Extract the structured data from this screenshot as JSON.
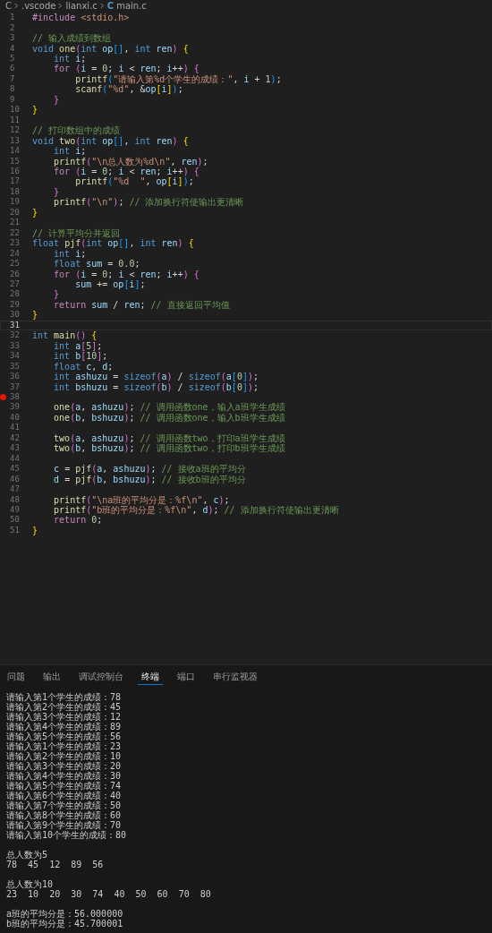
{
  "breadcrumb": [
    {
      "text": "C"
    },
    {
      "text": ".vscode"
    },
    {
      "text": "lianxi.c"
    },
    {
      "text": "main.c",
      "icon_label": "C"
    }
  ],
  "code_lines": [
    {
      "n": "1",
      "current": false,
      "breakpoint": false,
      "tokens": [
        {
          "kind": "ctl",
          "text": "#include "
        },
        {
          "kind": "str",
          "text": "<stdio.h>"
        }
      ]
    },
    {
      "n": "2",
      "current": false,
      "breakpoint": false
    },
    {
      "n": "3",
      "current": false,
      "breakpoint": false,
      "tokens": [
        {
          "kind": "cmt",
          "text": "// 输入成绩到数组"
        }
      ]
    },
    {
      "n": "4",
      "current": false,
      "breakpoint": false,
      "tokens": [
        {
          "kind": "kw",
          "text": "void "
        },
        {
          "kind": "fn",
          "text": "one"
        },
        {
          "kind": "br2",
          "text": "("
        },
        {
          "kind": "kw",
          "text": "int"
        },
        {
          "kind": "var",
          "text": " op"
        },
        {
          "kind": "br3",
          "text": "[]"
        },
        {
          "kind": "pun",
          "text": ", "
        },
        {
          "kind": "kw",
          "text": "int"
        },
        {
          "kind": "var",
          "text": " ren"
        },
        {
          "kind": "br2",
          "text": ") "
        },
        {
          "kind": "br1",
          "text": "{"
        }
      ]
    },
    {
      "n": "5",
      "current": false,
      "breakpoint": false,
      "tokens": [
        {
          "kind": "kw",
          "text": "    int"
        },
        {
          "kind": "var",
          "text": " i"
        },
        {
          "kind": "pun",
          "text": ";"
        }
      ]
    },
    {
      "n": "6",
      "current": false,
      "breakpoint": false,
      "tokens": [
        {
          "kind": "ctl",
          "text": "    for "
        },
        {
          "kind": "br2",
          "text": "("
        },
        {
          "kind": "var",
          "text": "i"
        },
        {
          "kind": "pun",
          "text": " = "
        },
        {
          "kind": "num",
          "text": "0"
        },
        {
          "kind": "pun",
          "text": "; "
        },
        {
          "kind": "var",
          "text": "i"
        },
        {
          "kind": "pun",
          "text": " < "
        },
        {
          "kind": "var",
          "text": "ren"
        },
        {
          "kind": "pun",
          "text": "; "
        },
        {
          "kind": "var",
          "text": "i"
        },
        {
          "kind": "pun",
          "text": "++"
        },
        {
          "kind": "br2",
          "text": ") {"
        }
      ]
    },
    {
      "n": "7",
      "current": false,
      "breakpoint": false,
      "tokens": [
        {
          "kind": "fn",
          "text": "        printf"
        },
        {
          "kind": "br3",
          "text": "("
        },
        {
          "kind": "str",
          "text": "\"请输入第%d个学生的成绩：\""
        },
        {
          "kind": "pun",
          "text": ", "
        },
        {
          "kind": "var",
          "text": "i"
        },
        {
          "kind": "pun",
          "text": " + "
        },
        {
          "kind": "num",
          "text": "1"
        },
        {
          "kind": "br3",
          "text": ")"
        },
        {
          "kind": "pun",
          "text": ";"
        }
      ]
    },
    {
      "n": "8",
      "current": false,
      "breakpoint": false,
      "tokens": [
        {
          "kind": "fn",
          "text": "        scanf"
        },
        {
          "kind": "br3",
          "text": "("
        },
        {
          "kind": "str",
          "text": "\"%d\""
        },
        {
          "kind": "pun",
          "text": ", &"
        },
        {
          "kind": "var",
          "text": "op"
        },
        {
          "kind": "br1",
          "text": "["
        },
        {
          "kind": "var",
          "text": "i"
        },
        {
          "kind": "br1",
          "text": "]"
        },
        {
          "kind": "br3",
          "text": ")"
        },
        {
          "kind": "pun",
          "text": ";"
        }
      ]
    },
    {
      "n": "9",
      "current": false,
      "breakpoint": false,
      "tokens": [
        {
          "kind": "br2",
          "text": "    }"
        }
      ]
    },
    {
      "n": "10",
      "current": false,
      "breakpoint": false,
      "tokens": [
        {
          "kind": "br1",
          "text": "}"
        }
      ]
    },
    {
      "n": "11",
      "current": false,
      "breakpoint": false
    },
    {
      "n": "12",
      "current": false,
      "breakpoint": false,
      "tokens": [
        {
          "kind": "cmt",
          "text": "// 打印数组中的成绩"
        }
      ]
    },
    {
      "n": "13",
      "current": false,
      "breakpoint": false,
      "tokens": [
        {
          "kind": "kw",
          "text": "void "
        },
        {
          "kind": "fn",
          "text": "two"
        },
        {
          "kind": "br2",
          "text": "("
        },
        {
          "kind": "kw",
          "text": "int"
        },
        {
          "kind": "var",
          "text": " op"
        },
        {
          "kind": "br3",
          "text": "[]"
        },
        {
          "kind": "pun",
          "text": ", "
        },
        {
          "kind": "kw",
          "text": "int"
        },
        {
          "kind": "var",
          "text": " ren"
        },
        {
          "kind": "br2",
          "text": ") "
        },
        {
          "kind": "br1",
          "text": "{"
        }
      ]
    },
    {
      "n": "14",
      "current": false,
      "breakpoint": false,
      "tokens": [
        {
          "kind": "kw",
          "text": "    int"
        },
        {
          "kind": "var",
          "text": " i"
        },
        {
          "kind": "pun",
          "text": ";"
        }
      ]
    },
    {
      "n": "15",
      "current": false,
      "breakpoint": false,
      "tokens": [
        {
          "kind": "fn",
          "text": "    printf"
        },
        {
          "kind": "br2",
          "text": "("
        },
        {
          "kind": "str",
          "text": "\"\\n总人数为%d\\n\""
        },
        {
          "kind": "pun",
          "text": ", "
        },
        {
          "kind": "var",
          "text": "ren"
        },
        {
          "kind": "br2",
          "text": ")"
        },
        {
          "kind": "pun",
          "text": ";"
        }
      ]
    },
    {
      "n": "16",
      "current": false,
      "breakpoint": false,
      "tokens": [
        {
          "kind": "ctl",
          "text": "    for "
        },
        {
          "kind": "br2",
          "text": "("
        },
        {
          "kind": "var",
          "text": "i"
        },
        {
          "kind": "pun",
          "text": " = "
        },
        {
          "kind": "num",
          "text": "0"
        },
        {
          "kind": "pun",
          "text": "; "
        },
        {
          "kind": "var",
          "text": "i"
        },
        {
          "kind": "pun",
          "text": " < "
        },
        {
          "kind": "var",
          "text": "ren"
        },
        {
          "kind": "pun",
          "text": "; "
        },
        {
          "kind": "var",
          "text": "i"
        },
        {
          "kind": "pun",
          "text": "++"
        },
        {
          "kind": "br2",
          "text": ") {"
        }
      ]
    },
    {
      "n": "17",
      "current": false,
      "breakpoint": false,
      "tokens": [
        {
          "kind": "fn",
          "text": "        printf"
        },
        {
          "kind": "br3",
          "text": "("
        },
        {
          "kind": "str",
          "text": "\"%d  \""
        },
        {
          "kind": "pun",
          "text": ", "
        },
        {
          "kind": "var",
          "text": "op"
        },
        {
          "kind": "br1",
          "text": "["
        },
        {
          "kind": "var",
          "text": "i"
        },
        {
          "kind": "br1",
          "text": "]"
        },
        {
          "kind": "br3",
          "text": ")"
        },
        {
          "kind": "pun",
          "text": ";"
        }
      ]
    },
    {
      "n": "18",
      "current": false,
      "breakpoint": false,
      "tokens": [
        {
          "kind": "br2",
          "text": "    }"
        }
      ]
    },
    {
      "n": "19",
      "current": false,
      "breakpoint": false,
      "tokens": [
        {
          "kind": "fn",
          "text": "    printf"
        },
        {
          "kind": "br2",
          "text": "("
        },
        {
          "kind": "str",
          "text": "\"\\n\""
        },
        {
          "kind": "br2",
          "text": ")"
        },
        {
          "kind": "pun",
          "text": "; "
        },
        {
          "kind": "cmt",
          "text": "// 添加换行符使输出更清晰"
        }
      ]
    },
    {
      "n": "20",
      "current": false,
      "breakpoint": false,
      "tokens": [
        {
          "kind": "br1",
          "text": "}"
        }
      ]
    },
    {
      "n": "21",
      "current": false,
      "breakpoint": false
    },
    {
      "n": "22",
      "current": false,
      "breakpoint": false,
      "tokens": [
        {
          "kind": "cmt",
          "text": "// 计算平均分并返回"
        }
      ]
    },
    {
      "n": "23",
      "current": false,
      "breakpoint": false,
      "tokens": [
        {
          "kind": "kw",
          "text": "float "
        },
        {
          "kind": "fn",
          "text": "pjf"
        },
        {
          "kind": "br2",
          "text": "("
        },
        {
          "kind": "kw",
          "text": "int"
        },
        {
          "kind": "var",
          "text": " op"
        },
        {
          "kind": "br3",
          "text": "[]"
        },
        {
          "kind": "pun",
          "text": ", "
        },
        {
          "kind": "kw",
          "text": "int"
        },
        {
          "kind": "var",
          "text": " ren"
        },
        {
          "kind": "br2",
          "text": ") "
        },
        {
          "kind": "br1",
          "text": "{"
        }
      ]
    },
    {
      "n": "24",
      "current": false,
      "breakpoint": false,
      "tokens": [
        {
          "kind": "kw",
          "text": "    int"
        },
        {
          "kind": "var",
          "text": " i"
        },
        {
          "kind": "pun",
          "text": ";"
        }
      ]
    },
    {
      "n": "25",
      "current": false,
      "breakpoint": false,
      "tokens": [
        {
          "kind": "kw",
          "text": "    float"
        },
        {
          "kind": "var",
          "text": " sum"
        },
        {
          "kind": "pun",
          "text": " = "
        },
        {
          "kind": "num",
          "text": "0.0"
        },
        {
          "kind": "pun",
          "text": ";"
        }
      ]
    },
    {
      "n": "26",
      "current": false,
      "breakpoint": false,
      "tokens": [
        {
          "kind": "ctl",
          "text": "    for "
        },
        {
          "kind": "br2",
          "text": "("
        },
        {
          "kind": "var",
          "text": "i"
        },
        {
          "kind": "pun",
          "text": " = "
        },
        {
          "kind": "num",
          "text": "0"
        },
        {
          "kind": "pun",
          "text": "; "
        },
        {
          "kind": "var",
          "text": "i"
        },
        {
          "kind": "pun",
          "text": " < "
        },
        {
          "kind": "var",
          "text": "ren"
        },
        {
          "kind": "pun",
          "text": "; "
        },
        {
          "kind": "var",
          "text": "i"
        },
        {
          "kind": "pun",
          "text": "++"
        },
        {
          "kind": "br2",
          "text": ") {"
        }
      ]
    },
    {
      "n": "27",
      "current": false,
      "breakpoint": false,
      "tokens": [
        {
          "kind": "var",
          "text": "        sum"
        },
        {
          "kind": "pun",
          "text": " += "
        },
        {
          "kind": "var",
          "text": "op"
        },
        {
          "kind": "br3",
          "text": "["
        },
        {
          "kind": "var",
          "text": "i"
        },
        {
          "kind": "br3",
          "text": "]"
        },
        {
          "kind": "pun",
          "text": ";"
        }
      ]
    },
    {
      "n": "28",
      "current": false,
      "breakpoint": false,
      "tokens": [
        {
          "kind": "br2",
          "text": "    }"
        }
      ]
    },
    {
      "n": "29",
      "current": false,
      "breakpoint": false,
      "tokens": [
        {
          "kind": "ctl",
          "text": "    return"
        },
        {
          "kind": "var",
          "text": " sum"
        },
        {
          "kind": "pun",
          "text": " / "
        },
        {
          "kind": "var",
          "text": "ren"
        },
        {
          "kind": "pun",
          "text": "; "
        },
        {
          "kind": "cmt",
          "text": "// 直接返回平均值"
        }
      ]
    },
    {
      "n": "30",
      "current": false,
      "breakpoint": false,
      "tokens": [
        {
          "kind": "br1",
          "text": "}"
        }
      ]
    },
    {
      "n": "31",
      "current": true,
      "breakpoint": false
    },
    {
      "n": "32",
      "current": false,
      "breakpoint": false,
      "tokens": [
        {
          "kind": "kw",
          "text": "int "
        },
        {
          "kind": "fn",
          "text": "main"
        },
        {
          "kind": "br2",
          "text": "() "
        },
        {
          "kind": "br1",
          "text": "{"
        }
      ]
    },
    {
      "n": "33",
      "current": false,
      "breakpoint": false,
      "tokens": [
        {
          "kind": "kw",
          "text": "    int"
        },
        {
          "kind": "var",
          "text": " a"
        },
        {
          "kind": "br2",
          "text": "["
        },
        {
          "kind": "num",
          "text": "5"
        },
        {
          "kind": "br2",
          "text": "]"
        },
        {
          "kind": "pun",
          "text": ";"
        }
      ]
    },
    {
      "n": "34",
      "current": false,
      "breakpoint": false,
      "tokens": [
        {
          "kind": "kw",
          "text": "    int"
        },
        {
          "kind": "var",
          "text": " b"
        },
        {
          "kind": "br2",
          "text": "["
        },
        {
          "kind": "num",
          "text": "10"
        },
        {
          "kind": "br2",
          "text": "]"
        },
        {
          "kind": "pun",
          "text": ";"
        }
      ]
    },
    {
      "n": "35",
      "current": false,
      "breakpoint": false,
      "tokens": [
        {
          "kind": "kw",
          "text": "    float"
        },
        {
          "kind": "var",
          "text": " c"
        },
        {
          "kind": "pun",
          "text": ", "
        },
        {
          "kind": "var",
          "text": "d"
        },
        {
          "kind": "pun",
          "text": ";"
        }
      ]
    },
    {
      "n": "36",
      "current": false,
      "breakpoint": false,
      "tokens": [
        {
          "kind": "kw",
          "text": "    int"
        },
        {
          "kind": "var",
          "text": " ashuzu"
        },
        {
          "kind": "pun",
          "text": " = "
        },
        {
          "kind": "kw",
          "text": "sizeof"
        },
        {
          "kind": "br2",
          "text": "("
        },
        {
          "kind": "var",
          "text": "a"
        },
        {
          "kind": "br2",
          "text": ")"
        },
        {
          "kind": "pun",
          "text": " / "
        },
        {
          "kind": "kw",
          "text": "sizeof"
        },
        {
          "kind": "br2",
          "text": "("
        },
        {
          "kind": "var",
          "text": "a"
        },
        {
          "kind": "br3",
          "text": "["
        },
        {
          "kind": "num",
          "text": "0"
        },
        {
          "kind": "br3",
          "text": "]"
        },
        {
          "kind": "br2",
          "text": ")"
        },
        {
          "kind": "pun",
          "text": ";"
        }
      ]
    },
    {
      "n": "37",
      "current": false,
      "breakpoint": false,
      "tokens": [
        {
          "kind": "kw",
          "text": "    int"
        },
        {
          "kind": "var",
          "text": " bshuzu"
        },
        {
          "kind": "pun",
          "text": " = "
        },
        {
          "kind": "kw",
          "text": "sizeof"
        },
        {
          "kind": "br2",
          "text": "("
        },
        {
          "kind": "var",
          "text": "b"
        },
        {
          "kind": "br2",
          "text": ")"
        },
        {
          "kind": "pun",
          "text": " / "
        },
        {
          "kind": "kw",
          "text": "sizeof"
        },
        {
          "kind": "br2",
          "text": "("
        },
        {
          "kind": "var",
          "text": "b"
        },
        {
          "kind": "br3",
          "text": "["
        },
        {
          "kind": "num",
          "text": "0"
        },
        {
          "kind": "br3",
          "text": "]"
        },
        {
          "kind": "br2",
          "text": ")"
        },
        {
          "kind": "pun",
          "text": ";"
        }
      ]
    },
    {
      "n": "38",
      "current": false,
      "breakpoint": true
    },
    {
      "n": "39",
      "current": false,
      "breakpoint": false,
      "tokens": [
        {
          "kind": "fn",
          "text": "    one"
        },
        {
          "kind": "br2",
          "text": "("
        },
        {
          "kind": "var",
          "text": "a"
        },
        {
          "kind": "pun",
          "text": ", "
        },
        {
          "kind": "var",
          "text": "ashuzu"
        },
        {
          "kind": "br2",
          "text": ")"
        },
        {
          "kind": "pun",
          "text": "; "
        },
        {
          "kind": "cmt",
          "text": "// 调用函数one，输入a班学生成绩"
        }
      ]
    },
    {
      "n": "40",
      "current": false,
      "breakpoint": false,
      "tokens": [
        {
          "kind": "fn",
          "text": "    one"
        },
        {
          "kind": "br2",
          "text": "("
        },
        {
          "kind": "var",
          "text": "b"
        },
        {
          "kind": "pun",
          "text": ", "
        },
        {
          "kind": "var",
          "text": "bshuzu"
        },
        {
          "kind": "br2",
          "text": ")"
        },
        {
          "kind": "pun",
          "text": "; "
        },
        {
          "kind": "cmt",
          "text": "// 调用函数one，输入b班学生成绩"
        }
      ]
    },
    {
      "n": "41",
      "current": false,
      "breakpoint": false
    },
    {
      "n": "42",
      "current": false,
      "breakpoint": false,
      "tokens": [
        {
          "kind": "fn",
          "text": "    two"
        },
        {
          "kind": "br2",
          "text": "("
        },
        {
          "kind": "var",
          "text": "a"
        },
        {
          "kind": "pun",
          "text": ", "
        },
        {
          "kind": "var",
          "text": "ashuzu"
        },
        {
          "kind": "br2",
          "text": ")"
        },
        {
          "kind": "pun",
          "text": "; "
        },
        {
          "kind": "cmt",
          "text": "// 调用函数two，打印a班学生成绩"
        }
      ]
    },
    {
      "n": "43",
      "current": false,
      "breakpoint": false,
      "tokens": [
        {
          "kind": "fn",
          "text": "    two"
        },
        {
          "kind": "br2",
          "text": "("
        },
        {
          "kind": "var",
          "text": "b"
        },
        {
          "kind": "pun",
          "text": ", "
        },
        {
          "kind": "var",
          "text": "bshuzu"
        },
        {
          "kind": "br2",
          "text": ")"
        },
        {
          "kind": "pun",
          "text": "; "
        },
        {
          "kind": "cmt",
          "text": "// 调用函数two，打印b班学生成绩"
        }
      ]
    },
    {
      "n": "44",
      "current": false,
      "breakpoint": false
    },
    {
      "n": "45",
      "current": false,
      "breakpoint": false,
      "tokens": [
        {
          "kind": "var",
          "text": "    c"
        },
        {
          "kind": "pun",
          "text": " = "
        },
        {
          "kind": "fn",
          "text": "pjf"
        },
        {
          "kind": "br2",
          "text": "("
        },
        {
          "kind": "var",
          "text": "a"
        },
        {
          "kind": "pun",
          "text": ", "
        },
        {
          "kind": "var",
          "text": "ashuzu"
        },
        {
          "kind": "br2",
          "text": ")"
        },
        {
          "kind": "pun",
          "text": "; "
        },
        {
          "kind": "cmt",
          "text": "// 接收a班的平均分"
        }
      ]
    },
    {
      "n": "46",
      "current": false,
      "breakpoint": false,
      "tokens": [
        {
          "kind": "var",
          "text": "    d"
        },
        {
          "kind": "pun",
          "text": " = "
        },
        {
          "kind": "fn",
          "text": "pjf"
        },
        {
          "kind": "br2",
          "text": "("
        },
        {
          "kind": "var",
          "text": "b"
        },
        {
          "kind": "pun",
          "text": ", "
        },
        {
          "kind": "var",
          "text": "bshuzu"
        },
        {
          "kind": "br2",
          "text": ")"
        },
        {
          "kind": "pun",
          "text": "; "
        },
        {
          "kind": "cmt",
          "text": "// 接收b班的平均分"
        }
      ]
    },
    {
      "n": "47",
      "current": false,
      "breakpoint": false
    },
    {
      "n": "48",
      "current": false,
      "breakpoint": false,
      "tokens": [
        {
          "kind": "fn",
          "text": "    printf"
        },
        {
          "kind": "br2",
          "text": "("
        },
        {
          "kind": "str",
          "text": "\"\\na班的平均分是：%f\\n\""
        },
        {
          "kind": "pun",
          "text": ", "
        },
        {
          "kind": "var",
          "text": "c"
        },
        {
          "kind": "br2",
          "text": ")"
        },
        {
          "kind": "pun",
          "text": ";"
        }
      ]
    },
    {
      "n": "49",
      "current": false,
      "breakpoint": false,
      "tokens": [
        {
          "kind": "fn",
          "text": "    printf"
        },
        {
          "kind": "br2",
          "text": "("
        },
        {
          "kind": "str",
          "text": "\"b班的平均分是：%f\\n\""
        },
        {
          "kind": "pun",
          "text": ", "
        },
        {
          "kind": "var",
          "text": "d"
        },
        {
          "kind": "br2",
          "text": ")"
        },
        {
          "kind": "pun",
          "text": "; "
        },
        {
          "kind": "cmt",
          "text": "// 添加换行符使输出更清晰"
        }
      ]
    },
    {
      "n": "50",
      "current": false,
      "breakpoint": false,
      "tokens": [
        {
          "kind": "ctl",
          "text": "    return "
        },
        {
          "kind": "num",
          "text": "0"
        },
        {
          "kind": "pun",
          "text": ";"
        }
      ]
    },
    {
      "n": "51",
      "current": false,
      "breakpoint": false,
      "tokens": [
        {
          "kind": "br1",
          "text": "}"
        }
      ]
    }
  ],
  "panel_tabs": [
    {
      "label": "问题",
      "selected": false
    },
    {
      "label": "输出",
      "selected": false
    },
    {
      "label": "调试控制台",
      "selected": false
    },
    {
      "label": "终端",
      "selected": true
    },
    {
      "label": "端口",
      "selected": false
    },
    {
      "label": "串行监视器",
      "selected": false
    }
  ],
  "terminal_blocks": [
    [
      "请输入第1个学生的成绩：78",
      "请输入第2个学生的成绩：45",
      "请输入第3个学生的成绩：12",
      "请输入第4个学生的成绩：89",
      "请输入第5个学生的成绩：56",
      "请输入第1个学生的成绩：23",
      "请输入第2个学生的成绩：10",
      "请输入第3个学生的成绩：20",
      "请输入第4个学生的成绩：30",
      "请输入第5个学生的成绩：74",
      "请输入第6个学生的成绩：40",
      "请输入第7个学生的成绩：50",
      "请输入第8个学生的成绩：60",
      "请输入第9个学生的成绩：70",
      "请输入第10个学生的成绩：80"
    ],
    [
      "总人数为5",
      "78  45  12  89  56"
    ],
    [
      "总人数为10",
      "23  10  20  30  74  40  50  60  70  80"
    ],
    [
      "a班的平均分是：56.000000",
      "b班的平均分是：45.700001"
    ]
  ]
}
